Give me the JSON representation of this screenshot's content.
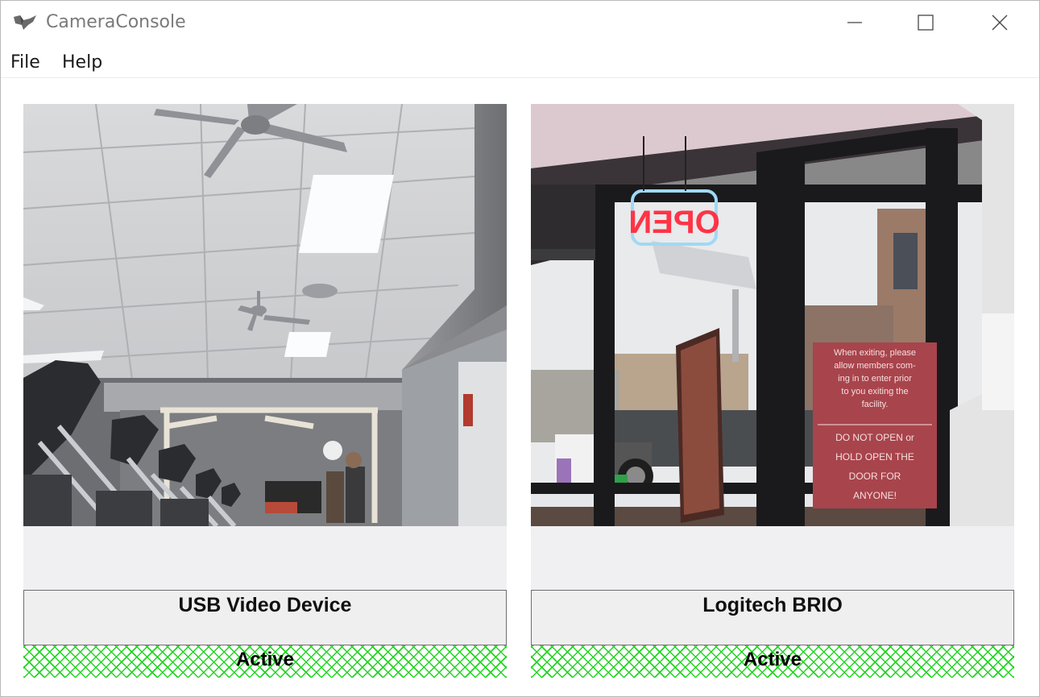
{
  "window": {
    "title": "CameraConsole",
    "icon": "bird-icon",
    "controls": [
      "minimize-icon",
      "maximize-icon",
      "close-icon"
    ]
  },
  "menu": {
    "items": [
      {
        "label": "File"
      },
      {
        "label": "Help"
      }
    ]
  },
  "cameras": [
    {
      "name": "USB Video Device",
      "status": "Active",
      "status_color": "#22d422"
    },
    {
      "name": "Logitech BRIO",
      "status": "Active",
      "status_color": "#22d422",
      "feed_sign": {
        "neon": "OPEN",
        "door_notice": "When exiting, please allow members coming in to enter prior to you exiting the facility. DO NOT OPEN or HOLD OPEN THE DOOR FOR ANYONE!"
      }
    }
  ]
}
